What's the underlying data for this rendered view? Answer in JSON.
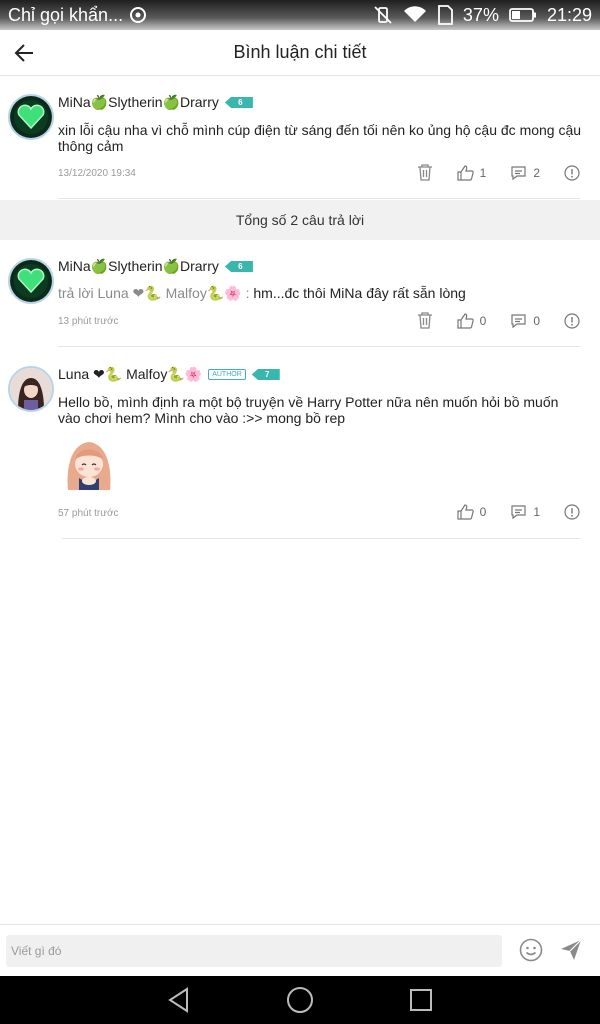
{
  "status_bar": {
    "notification": "Chỉ gọi khẩn...",
    "battery": "37%",
    "time": "21:29"
  },
  "header": {
    "title": "Bình luận chi tiết"
  },
  "main_comment": {
    "author": "MiNa🍏Slytherin🍏Drarry",
    "level": "6",
    "text": "xin lỗi cậu nha vì chỗ mình cúp điện từ sáng đến tối nên ko ủng hộ cậu đc mong cậu thông cảm",
    "timestamp": "13/12/2020 19:34",
    "likes": "1",
    "replies": "2"
  },
  "summary": {
    "label": "Tổng số 2 câu trả lời"
  },
  "replies": [
    {
      "author": "MiNa🍏Slytherin🍏Drarry",
      "level": "6",
      "reply_prefix": "trả lời Luna ❤🐍 Malfoy🐍🌸 :",
      "text": " hm...đc thôi MiNa đây rất sẵn lòng",
      "timestamp": "13 phút trước",
      "likes": "0",
      "replies": "0"
    },
    {
      "author": "Luna ❤🐍 Malfoy🐍🌸",
      "author_tag": "AUTHOR",
      "level": "7",
      "text": "Hello bồ, mình định ra một bộ truyện về Harry Potter nữa nên muốn hỏi bồ muốn vào chơi hem? Mình cho vào :>> mong bồ rep",
      "timestamp": "57 phút trước",
      "likes": "0",
      "replies": "1"
    }
  ],
  "composer": {
    "placeholder": "Viết gì đó"
  },
  "icons": {
    "back": "arrow-left-icon",
    "delete": "trash-icon",
    "like": "thumbs-up-icon",
    "reply": "comment-icon",
    "report": "info-circle-icon",
    "emoji": "smiley-icon",
    "send": "paper-plane-icon"
  },
  "colors": {
    "level_badge": "#39b7ad",
    "author_tag": "#41a7e0",
    "summary_band": "#f1f1f1"
  }
}
